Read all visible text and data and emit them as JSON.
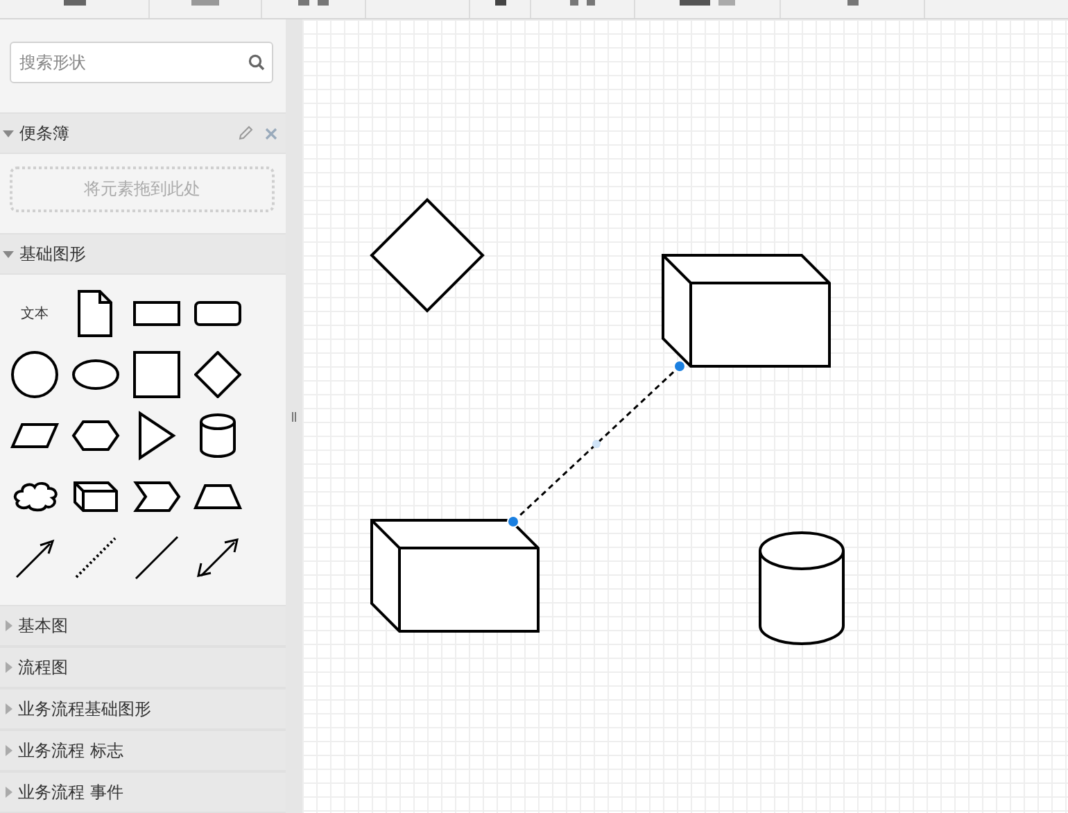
{
  "search": {
    "placeholder": "搜索形状"
  },
  "scratchpad": {
    "title": "便条簿",
    "expanded": true,
    "drop_hint": "将元素拖到此处"
  },
  "sections": [
    {
      "title": "基础图形",
      "expanded": true,
      "palette": [
        {
          "kind": "text",
          "label": "文本"
        },
        {
          "kind": "page"
        },
        {
          "kind": "rect"
        },
        {
          "kind": "rounded"
        },
        {
          "kind": "circle"
        },
        {
          "kind": "ellipse"
        },
        {
          "kind": "square"
        },
        {
          "kind": "diamond"
        },
        {
          "kind": "parallelogram"
        },
        {
          "kind": "hexagon"
        },
        {
          "kind": "triangle"
        },
        {
          "kind": "cylinder"
        },
        {
          "kind": "cloud"
        },
        {
          "kind": "cube"
        },
        {
          "kind": "step"
        },
        {
          "kind": "trapezoid"
        },
        {
          "kind": "arrow"
        },
        {
          "kind": "dotted"
        },
        {
          "kind": "line"
        },
        {
          "kind": "double-arrow"
        }
      ]
    },
    {
      "title": "基本图",
      "expanded": false
    },
    {
      "title": "流程图",
      "expanded": false
    },
    {
      "title": "业务流程基础图形",
      "expanded": false
    },
    {
      "title": "业务流程 标志",
      "expanded": false
    },
    {
      "title": "业务流程 事件",
      "expanded": false
    }
  ]
}
